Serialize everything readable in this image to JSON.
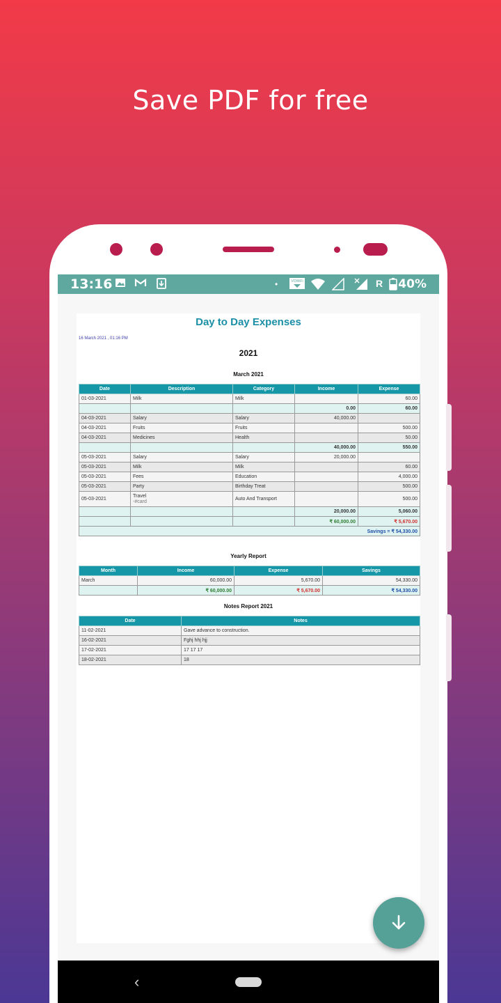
{
  "promo": {
    "headline": "Save PDF for free"
  },
  "status_bar": {
    "time": "13:16",
    "battery": "40%",
    "carrier_label": "R",
    "volte_label": "VOWiFi",
    "icons": [
      "image-icon",
      "gmail-icon",
      "download-icon",
      "wifi-icon",
      "signal-icon",
      "battery-icon"
    ]
  },
  "report": {
    "title": "Day to Day Expenses",
    "generated_at": "16 March 2021 , 01:16 PM",
    "year": "2021",
    "month_section": {
      "title": "March 2021",
      "headers": [
        "Date",
        "Description",
        "Category",
        "Income",
        "Expense"
      ],
      "rows": [
        {
          "type": "row",
          "cells": [
            "01-03-2021",
            "Milk",
            "Milk",
            "",
            "60.00"
          ]
        },
        {
          "type": "total",
          "cells": [
            "",
            "",
            "",
            "0.00",
            "60.00"
          ]
        },
        {
          "type": "row",
          "cells": [
            "04-03-2021",
            "Salary",
            "Salary",
            "40,000.00",
            ""
          ]
        },
        {
          "type": "row",
          "cells": [
            "04-03-2021",
            "Fruits",
            "Fruits",
            "",
            "500.00"
          ]
        },
        {
          "type": "row",
          "cells": [
            "04-03-2021",
            "Medicines",
            "Health",
            "",
            "50.00"
          ]
        },
        {
          "type": "total",
          "cells": [
            "",
            "",
            "",
            "40,000.00",
            "550.00"
          ]
        },
        {
          "type": "row",
          "cells": [
            "05-03-2021",
            "Salary",
            "Salary",
            "20,000.00",
            ""
          ]
        },
        {
          "type": "row",
          "cells": [
            "05-03-2021",
            "Milk",
            "Milk",
            "",
            "60.00"
          ]
        },
        {
          "type": "row",
          "cells": [
            "05-03-2021",
            "Fees",
            "Education",
            "",
            "4,000.00"
          ]
        },
        {
          "type": "row",
          "cells": [
            "05-03-2021",
            "Party",
            "Birthday Treat",
            "",
            "500.00"
          ]
        },
        {
          "type": "row2",
          "cells": [
            "05-03-2021",
            "Travel",
            "Auto And Transport",
            "",
            "500.00"
          ],
          "sub": "-#card"
        },
        {
          "type": "total",
          "cells": [
            "",
            "",
            "",
            "20,000.00",
            "5,060.00"
          ]
        },
        {
          "type": "grand",
          "cells": [
            "",
            "",
            "",
            "₹ 60,000.00",
            "₹ 5,670.00"
          ]
        }
      ],
      "savings": "Savings = ₹ 54,330.00"
    },
    "yearly": {
      "title": "Yearly Report",
      "headers": [
        "Month",
        "Income",
        "Expense",
        "Savings"
      ],
      "rows": [
        [
          "March",
          "60,000.00",
          "5,670.00",
          "54,330.00"
        ]
      ],
      "totals": [
        "",
        "₹ 60,000.00",
        "₹ 5,670.00",
        "₹ 54,330.00"
      ]
    },
    "notes": {
      "title": "Notes Report 2021",
      "headers": [
        "Date",
        "Notes"
      ],
      "rows": [
        [
          "11-02-2021",
          "Gave advance to construction."
        ],
        [
          "16-02-2021",
          "Fghj hhj hjj"
        ],
        [
          "17-02-2021",
          "17 17 17"
        ],
        [
          "18-02-2021",
          "18"
        ]
      ]
    }
  },
  "fab": {
    "icon": "arrow-down-icon"
  },
  "nav": {
    "back_icon": "‹"
  },
  "colors": {
    "accent": "#1597a7",
    "status_bar": "#5ea89f",
    "fab": "#55a198",
    "phone_accent": "#b81d4e"
  }
}
